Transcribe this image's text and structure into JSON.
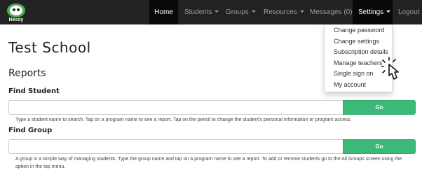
{
  "brand": {
    "name": "Nessy",
    "logo_icon": "nessy-logo-icon"
  },
  "nav": {
    "home": "Home",
    "students": "Students",
    "groups": "Groups",
    "resources": "Resources",
    "messages": "Messages (0)",
    "settings": "Settings",
    "logout": "Logout"
  },
  "settings_menu": {
    "items": [
      "Change password",
      "Change settings",
      "Subscription details",
      "Manage teachers",
      "Single sign on",
      "My account"
    ]
  },
  "page": {
    "title": "Test School",
    "section": "Reports"
  },
  "find_student": {
    "label": "Find Student",
    "input_value": "",
    "button": "Go",
    "help": "Type a student name to search. Tap on a program name to see a report. Tap on the pencil to change the student's personal information or program access."
  },
  "find_group": {
    "label": "Find Group",
    "input_value": "",
    "button": "Go",
    "help": "A group is a simple way of managing students. Type the group name and tap on a program name to see a report. To add or remove students go to the All Groups screen using the option in the top menu."
  },
  "colors": {
    "nav_bg": "#222222",
    "nav_active_bg": "#080808",
    "go_button": "#3cb878"
  },
  "icons": {
    "pointer": "hand-pointer-cursor-icon"
  }
}
